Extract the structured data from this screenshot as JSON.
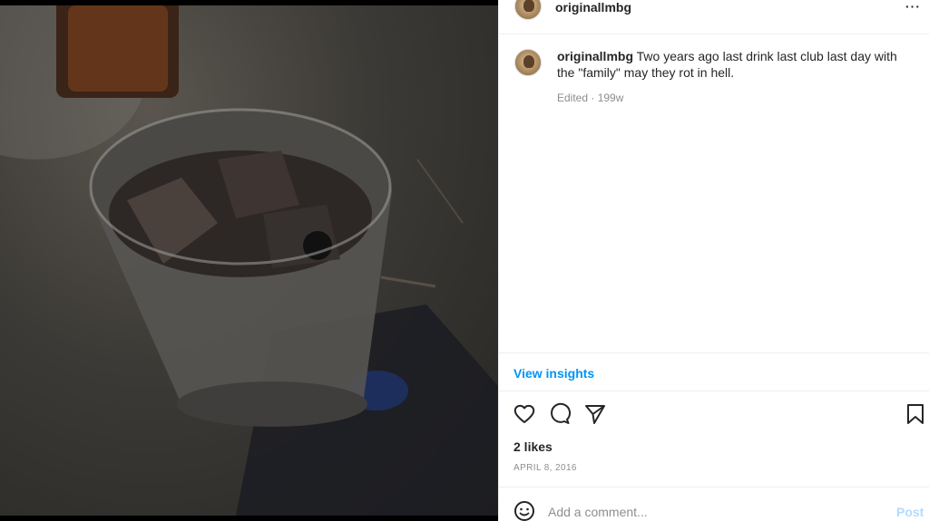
{
  "post": {
    "username": "originallmbg",
    "more_icon": "more-horizontal-icon",
    "photo_alt": "Glass of whiskey with ice on a dark table"
  },
  "caption": {
    "username": "originallmbg",
    "text": "Two years ago last drink last club last day with the \"family\" may they rot in hell.",
    "meta": "Edited · 199w"
  },
  "insights": {
    "label": "View insights"
  },
  "actions": {
    "like_icon": "heart-icon",
    "comment_icon": "comment-icon",
    "share_icon": "share-icon",
    "save_icon": "bookmark-icon"
  },
  "likes": "2 likes",
  "date": "APRIL 8, 2016",
  "comment_box": {
    "placeholder": "Add a comment...",
    "post_label": "Post",
    "emoji_icon": "emoji-icon"
  },
  "colors": {
    "link_blue": "#0095f6",
    "post_disabled": "#b3dbff",
    "meta_gray": "#8e8e8e",
    "divider": "#efefef"
  }
}
